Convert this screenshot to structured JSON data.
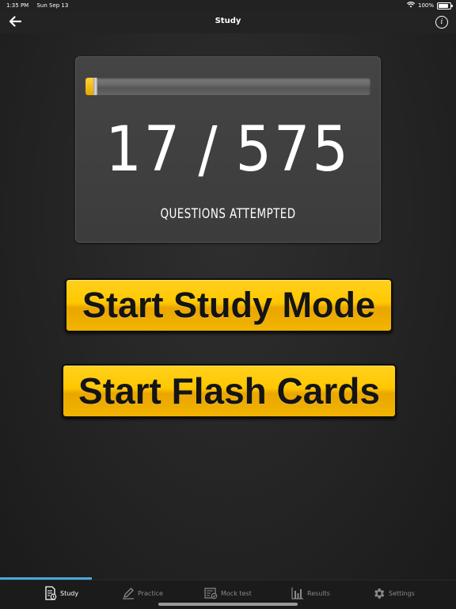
{
  "status_bar": {
    "time": "1:35 PM",
    "date": "Sun Sep 13",
    "battery": "100%",
    "battery_level": 1.0
  },
  "nav": {
    "title": "Study",
    "back_icon": "arrow-left-icon",
    "info_icon": "info-icon"
  },
  "progress": {
    "attempted": "17",
    "total": "575",
    "separator": "/",
    "label": "QUESTIONS ATTEMPTED",
    "fraction": 0.0296
  },
  "buttons": {
    "study_mode": "Start Study Mode",
    "flash_cards": "Start Flash Cards"
  },
  "tabs": [
    {
      "label": "Study",
      "icon": "study-doc-icon",
      "active": true
    },
    {
      "label": "Practice",
      "icon": "pencil-icon",
      "active": false
    },
    {
      "label": "Mock test",
      "icon": "mock-test-icon",
      "active": false
    },
    {
      "label": "Results",
      "icon": "bar-chart-icon",
      "active": false
    },
    {
      "label": "Settings",
      "icon": "gear-icon",
      "active": false
    }
  ],
  "colors": {
    "accent_yellow": "#ffc700",
    "tab_indicator": "#4aa8d8",
    "background": "#262626"
  }
}
